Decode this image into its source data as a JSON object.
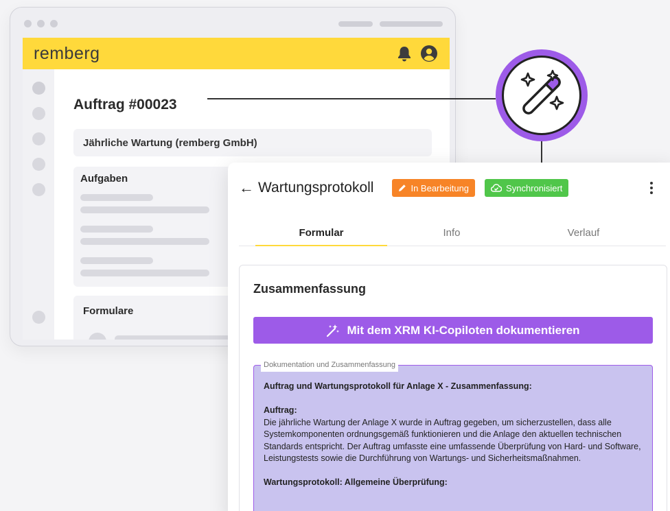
{
  "back_app": {
    "logo": "remberg",
    "order_title": "Auftrag #00023",
    "job_card": "Jährliche Wartung (remberg GmbH)",
    "tasks_title": "Aufgaben",
    "forms_title": "Formulare"
  },
  "panel": {
    "title": "Wartungsprotokoll",
    "badge_status": "In Bearbeitung",
    "badge_sync": "Synchronisiert",
    "tabs": [
      {
        "label": "Formular"
      },
      {
        "label": "Info"
      },
      {
        "label": "Verlauf"
      }
    ],
    "section_title": "Zusammenfassung",
    "ai_button_label": "Mit dem XRM KI-Copiloten dokumentieren",
    "doc_legend": "Dokumentation und Zusammenfassung",
    "doc": {
      "heading": "Auftrag und Wartungsprotokoll für Anlage X - Zusammenfassung:",
      "sub1": "Auftrag:",
      "para1": "Die jährliche Wartung der Anlage X wurde in Auftrag gegeben, um sicherzustellen, dass alle Systemkomponenten ordnungsgemäß funktionieren und die Anlage den aktuellen technischen Standards entspricht. Der Auftrag umfasste eine umfassende Überprüfung von Hard- und Software, Leistungstests sowie die Durchführung von Wartungs- und Sicherheitsmaßnahmen.",
      "sub2": "Wartungsprotokoll: Allgemeine Überprüfung:"
    }
  },
  "colors": {
    "brand_yellow": "#ffd93b",
    "accent_purple": "#9d5be8",
    "status_orange": "#f78427",
    "status_green": "#50c64a",
    "doc_background": "#c9c3ef"
  },
  "icons": {
    "header": [
      "bell-icon",
      "account-icon"
    ],
    "badge_status": "pencil-icon",
    "badge_sync": "cloud-check-icon",
    "ai_button": "magic-wand-icon",
    "circle": "magic-wand-sparkles-icon"
  }
}
